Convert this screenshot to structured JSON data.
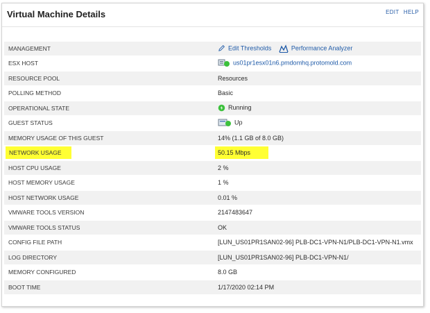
{
  "header": {
    "title": "Virtual Machine Details",
    "edit": "EDIT",
    "help": "HELP"
  },
  "rows": [
    {
      "label": "MANAGEMENT",
      "edit_thresholds": "Edit Thresholds",
      "performance_analyzer": "Performance Analyzer"
    },
    {
      "label": "ESX HOST",
      "value": "us01pr1esx01n6.pmdomhq.protomold.com"
    },
    {
      "label": "RESOURCE POOL",
      "value": "Resources"
    },
    {
      "label": "POLLING METHOD",
      "value": "Basic"
    },
    {
      "label": "OPERATIONAL STATE",
      "value": "Running"
    },
    {
      "label": "GUEST STATUS",
      "value": "Up"
    },
    {
      "label": "MEMORY USAGE OF THIS GUEST",
      "value": "14% (1.1 GB of 8.0 GB)"
    },
    {
      "label": "NETWORK USAGE",
      "value": "50.15 Mbps"
    },
    {
      "label": "HOST CPU USAGE",
      "value": "2 %"
    },
    {
      "label": "HOST MEMORY USAGE",
      "value": "1 %"
    },
    {
      "label": "HOST NETWORK USAGE",
      "value": "0.01 %"
    },
    {
      "label": "VMWARE TOOLS VERSION",
      "value": "2147483647"
    },
    {
      "label": "VMWARE TOOLS STATUS",
      "value": "OK"
    },
    {
      "label": "CONFIG FILE PATH",
      "value": "[LUN_US01PR1SAN02-96] PLB-DC1-VPN-N1/PLB-DC1-VPN-N1.vmx"
    },
    {
      "label": "LOG DIRECTORY",
      "value": "[LUN_US01PR1SAN02-96] PLB-DC1-VPN-N1/"
    },
    {
      "label": "MEMORY CONFIGURED",
      "value": "8.0 GB"
    },
    {
      "label": "BOOT TIME",
      "value": "1/17/2020 02:14 PM"
    }
  ],
  "icons": {
    "edit": "pencil-icon",
    "performance": "performance-analyzer-icon",
    "host": "esx-host-icon",
    "state": "running-status-icon",
    "guest": "guest-status-icon"
  },
  "colors": {
    "highlight": "#ffff33",
    "link": "#1e5aa8",
    "status_green": "#3cc13c"
  }
}
